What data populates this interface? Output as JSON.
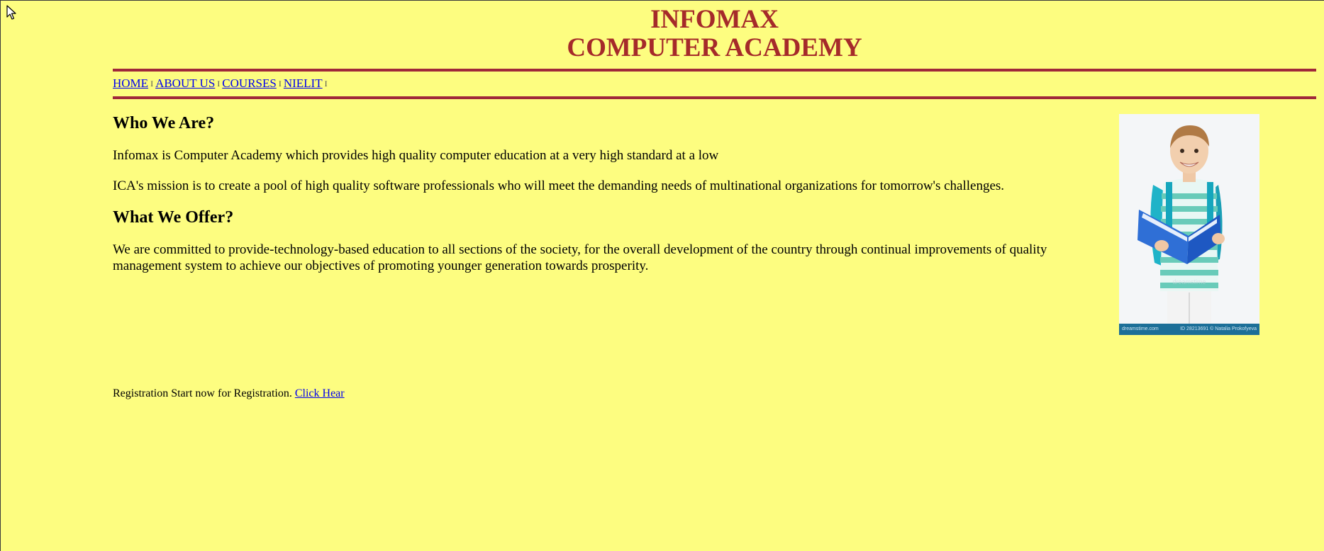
{
  "header": {
    "title_line1": "INFOMAX",
    "title_line2": "COMPUTER ACADEMY"
  },
  "nav": {
    "items": [
      {
        "label": "HOME"
      },
      {
        "label": "ABOUT US"
      },
      {
        "label": "COURSES"
      },
      {
        "label": "NIELIT"
      }
    ],
    "separator": "I"
  },
  "main": {
    "heading_who": "Who We Are?",
    "para_1": "Infomax is Computer Academy which provides high quality computer education at a very high standard at a low",
    "para_2": "ICA's mission is to create a pool of high quality software professionals who will meet the demanding needs of multinational organizations for tomorrow's challenges.",
    "heading_offer": "What We Offer?",
    "para_3": "We are committed to provide-technology-based education to all sections of the society, for the overall development of the country through continual improvements of quality management system to achieve our objectives of promoting younger generation towards prosperity."
  },
  "photo": {
    "watermark_left": "dreamstime.com",
    "watermark_right": "ID 28213691 © Natalia Prokofyeva"
  },
  "registration": {
    "text": "Registration Start now for Registration.",
    "link_label": "Click Hear"
  },
  "colors": {
    "background": "#fdfd80",
    "title": "#a52a2a",
    "rule": "#a0283a",
    "link": "#0000ee"
  }
}
